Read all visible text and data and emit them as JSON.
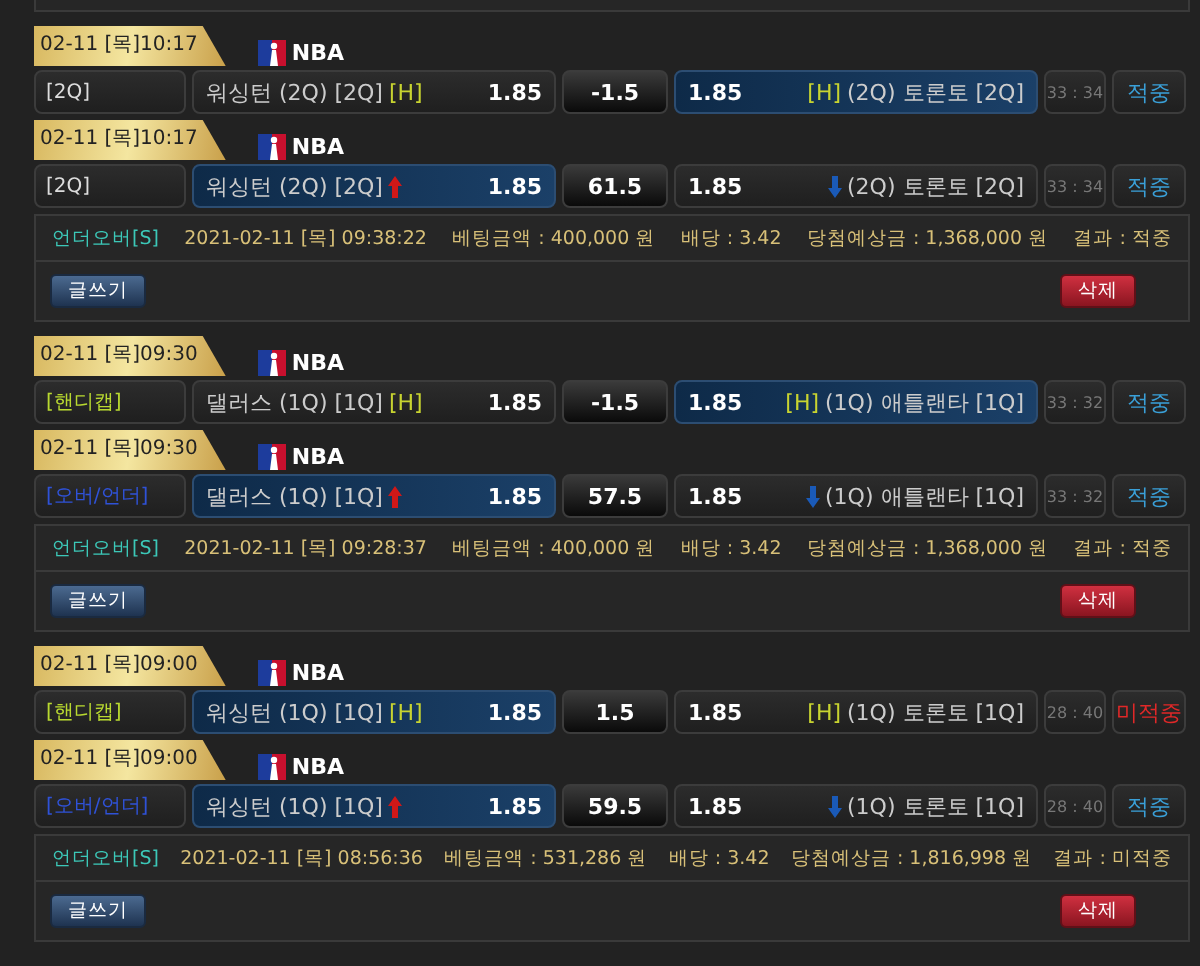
{
  "bets": [
    {
      "games": [
        {
          "date": "02-11 [목]10:17",
          "league": "NBA",
          "type": {
            "label": "[2Q]",
            "kind": "plain"
          },
          "home": {
            "name": "워싱턴 (2Q) [2Q]",
            "tag": "[H]",
            "odds": "1.85",
            "selected": false
          },
          "line": "-1.5",
          "away": {
            "name": "(2Q) 토론토 [2Q]",
            "tag": "[H]",
            "odds": "1.85",
            "selected": true
          },
          "score": "33 : 34",
          "result": {
            "label": "적중",
            "won": true
          }
        },
        {
          "date": "02-11 [목]10:17",
          "league": "NBA",
          "type": {
            "label": "[2Q]",
            "kind": "plain"
          },
          "home": {
            "name": "워싱턴 (2Q) [2Q]",
            "kind": "up",
            "odds": "1.85",
            "selected": true
          },
          "line": "61.5",
          "away": {
            "name": "(2Q) 토론토 [2Q]",
            "kind": "down",
            "odds": "1.85",
            "selected": false
          },
          "score": "33 : 34",
          "result": {
            "label": "적중",
            "won": true
          }
        }
      ],
      "summary": {
        "kind": "언더오버[S]",
        "time": "2021-02-11 [목] 09:38:22",
        "amount": "베팅금액 : 400,000 원",
        "odds": "배당 : 3.42",
        "payout": "당첨예상금 : 1,368,000 원",
        "result": "결과 : 적중"
      },
      "buttons": {
        "write": "글쓰기",
        "delete": "삭제"
      }
    },
    {
      "games": [
        {
          "date": "02-11 [목]09:30",
          "league": "NBA",
          "type": {
            "label": "[핸디캡]",
            "kind": "handicap"
          },
          "home": {
            "name": "댈러스 (1Q) [1Q]",
            "tag": "[H]",
            "odds": "1.85",
            "selected": false
          },
          "line": "-1.5",
          "away": {
            "name": "(1Q) 애틀랜타 [1Q]",
            "tag": "[H]",
            "odds": "1.85",
            "selected": true
          },
          "score": "33 : 32",
          "result": {
            "label": "적중",
            "won": true
          }
        },
        {
          "date": "02-11 [목]09:30",
          "league": "NBA",
          "type": {
            "label": "[오버/언더]",
            "kind": "overunder"
          },
          "home": {
            "name": "댈러스 (1Q) [1Q]",
            "kind": "up",
            "odds": "1.85",
            "selected": true
          },
          "line": "57.5",
          "away": {
            "name": "(1Q) 애틀랜타 [1Q]",
            "kind": "down",
            "odds": "1.85",
            "selected": false
          },
          "score": "33 : 32",
          "result": {
            "label": "적중",
            "won": true
          }
        }
      ],
      "summary": {
        "kind": "언더오버[S]",
        "time": "2021-02-11 [목] 09:28:37",
        "amount": "베팅금액 : 400,000 원",
        "odds": "배당 : 3.42",
        "payout": "당첨예상금 : 1,368,000 원",
        "result": "결과 : 적중"
      },
      "buttons": {
        "write": "글쓰기",
        "delete": "삭제"
      }
    },
    {
      "games": [
        {
          "date": "02-11 [목]09:00",
          "league": "NBA",
          "type": {
            "label": "[핸디캡]",
            "kind": "handicap"
          },
          "home": {
            "name": "워싱턴 (1Q) [1Q]",
            "tag": "[H]",
            "odds": "1.85",
            "selected": true
          },
          "line": "1.5",
          "away": {
            "name": "(1Q) 토론토 [1Q]",
            "tag": "[H]",
            "odds": "1.85",
            "selected": false
          },
          "score": "28 : 40",
          "result": {
            "label": "미적중",
            "won": false
          }
        },
        {
          "date": "02-11 [목]09:00",
          "league": "NBA",
          "type": {
            "label": "[오버/언더]",
            "kind": "overunder"
          },
          "home": {
            "name": "워싱턴 (1Q) [1Q]",
            "kind": "up",
            "odds": "1.85",
            "selected": true
          },
          "line": "59.5",
          "away": {
            "name": "(1Q) 토론토 [1Q]",
            "kind": "down",
            "odds": "1.85",
            "selected": false
          },
          "score": "28 : 40",
          "result": {
            "label": "적중",
            "won": true
          }
        }
      ],
      "summary": {
        "kind": "언더오버[S]",
        "time": "2021-02-11 [목] 08:56:36",
        "amount": "베팅금액 : 531,286 원",
        "odds": "배당 : 3.42",
        "payout": "당첨예상금 : 1,816,998 원",
        "result": "결과 : 미적중"
      },
      "buttons": {
        "write": "글쓰기",
        "delete": "삭제"
      }
    }
  ]
}
